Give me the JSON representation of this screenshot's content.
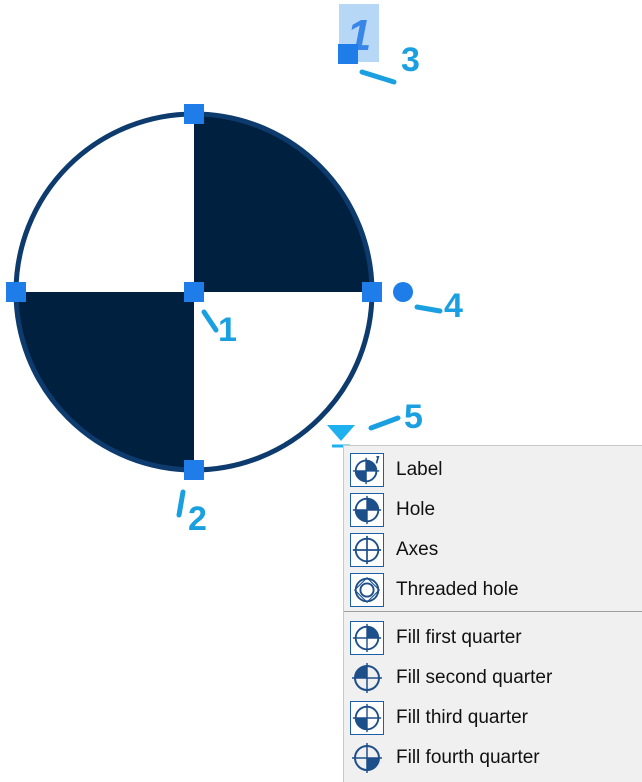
{
  "callouts": {
    "label_1": "1",
    "label_2": "2",
    "label_3": "3",
    "label_4": "4",
    "label_5": "5"
  },
  "label_glyph": "1",
  "colors": {
    "fill_dark": "#00203f",
    "circle_stroke": "#0d3b6e",
    "grip": "#1e7de8",
    "callout": "#1aa0e0",
    "menu_bg": "#f0f0f0"
  },
  "context_menu": {
    "items_group1": [
      {
        "label": "Label",
        "icon": "label-icon"
      },
      {
        "label": "Hole",
        "icon": "hole-icon"
      },
      {
        "label": "Axes",
        "icon": "axes-icon"
      },
      {
        "label": "Threaded hole",
        "icon": "threaded-hole-icon"
      }
    ],
    "items_group2": [
      {
        "label": "Fill first quarter",
        "icon": "fill-first-quarter-icon"
      },
      {
        "label": "Fill second quarter",
        "icon": "fill-second-quarter-icon"
      },
      {
        "label": "Fill third quarter",
        "icon": "fill-third-quarter-icon"
      },
      {
        "label": "Fill fourth quarter",
        "icon": "fill-fourth-quarter-icon"
      }
    ]
  }
}
